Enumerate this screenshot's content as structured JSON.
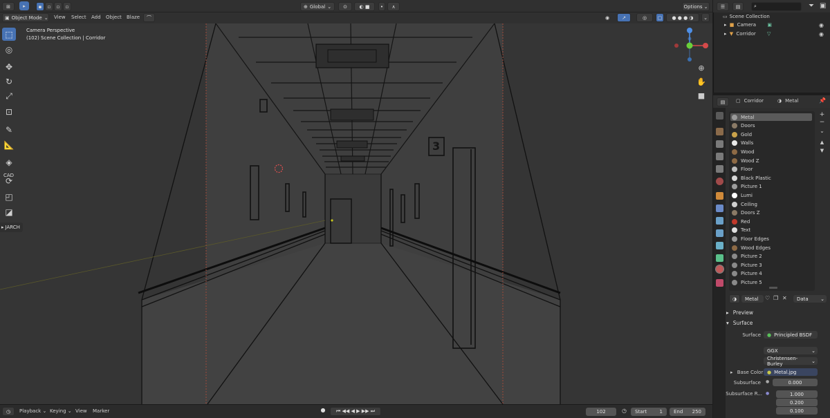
{
  "header": {
    "editor_type_icon": "view3d-icon",
    "mode_label": "Object Mode",
    "menus": [
      "View",
      "Select",
      "Add",
      "Object",
      "Blaze"
    ],
    "transform_orientation": "Global",
    "options_label": "Options"
  },
  "viewport": {
    "info_line1": "Camera Perspective",
    "info_line2": "(102) Scene Collection | Corridor",
    "room_number": "3",
    "gizmo_axes": [
      "X",
      "Y",
      "Z"
    ]
  },
  "toolbar": {
    "tools": [
      "select-box-icon",
      "cursor-icon",
      "move-icon",
      "rotate-icon",
      "scale-icon",
      "transform-icon",
      "annotate-icon",
      "measure-icon",
      "add-cube-icon",
      "cad-icon",
      "bevel-icon",
      "knife-icon"
    ],
    "cad_label": "CAD",
    "jarch_label": "JARCH"
  },
  "timeline": {
    "playback_label": "Playback",
    "keying_label": "Keying",
    "view_label": "View",
    "marker_label": "Marker",
    "current_frame": "102",
    "start_label": "Start",
    "start_value": "1",
    "end_label": "End",
    "end_value": "250"
  },
  "outliner": {
    "root": "Scene Collection",
    "items": [
      {
        "label": "Camera",
        "icon": "camera-icon"
      },
      {
        "label": "Corridor",
        "icon": "mesh-icon"
      }
    ]
  },
  "properties": {
    "object_name": "Corridor",
    "material_name": "Metal",
    "materials": [
      {
        "label": "Metal",
        "color": "#9a9a9a"
      },
      {
        "label": "Doors",
        "color": "#8a7a66"
      },
      {
        "label": "Gold",
        "color": "#c9a24a"
      },
      {
        "label": "Walls",
        "color": "#e8e8e8"
      },
      {
        "label": "Wood",
        "color": "#8d6a45"
      },
      {
        "label": "Wood Z",
        "color": "#8d6a45"
      },
      {
        "label": "Floor",
        "color": "#bdbdbd"
      },
      {
        "label": "Black Plastic",
        "color": "#d8d8d8"
      },
      {
        "label": "Picture 1",
        "color": "#9c9c9c"
      },
      {
        "label": "Lumi",
        "color": "#ffffff"
      },
      {
        "label": "Ceiling",
        "color": "#d0d0d0"
      },
      {
        "label": "Doors Z",
        "color": "#8a7a66"
      },
      {
        "label": "Red",
        "color": "#c0392b"
      },
      {
        "label": "Text",
        "color": "#e0e0e0"
      },
      {
        "label": "Floor Edges",
        "color": "#9a9a9a"
      },
      {
        "label": "Wood Edges",
        "color": "#8d6a45"
      },
      {
        "label": "Picture 2",
        "color": "#8a8a8a"
      },
      {
        "label": "Picture 3",
        "color": "#8a8a8a"
      },
      {
        "label": "Picture 4",
        "color": "#8a8a8a"
      },
      {
        "label": "Picture 5",
        "color": "#8a8a8a"
      }
    ],
    "slot_material": "Metal",
    "link_label": "Data",
    "preview_label": "Preview",
    "surface_section": "Surface",
    "surface_label": "Surface",
    "surface_value": "Principled BSDF",
    "distribution": "GGX",
    "subsurface_method": "Christensen-Burley",
    "base_color_label": "Base Color",
    "base_color_value": "Metal.jpg",
    "subsurface_label": "Subsurface",
    "subsurface_value": "0.000",
    "subsurface_radius_label": "Subsurface R...",
    "subsurface_radius": [
      "1.000",
      "0.200",
      "0.100"
    ]
  }
}
